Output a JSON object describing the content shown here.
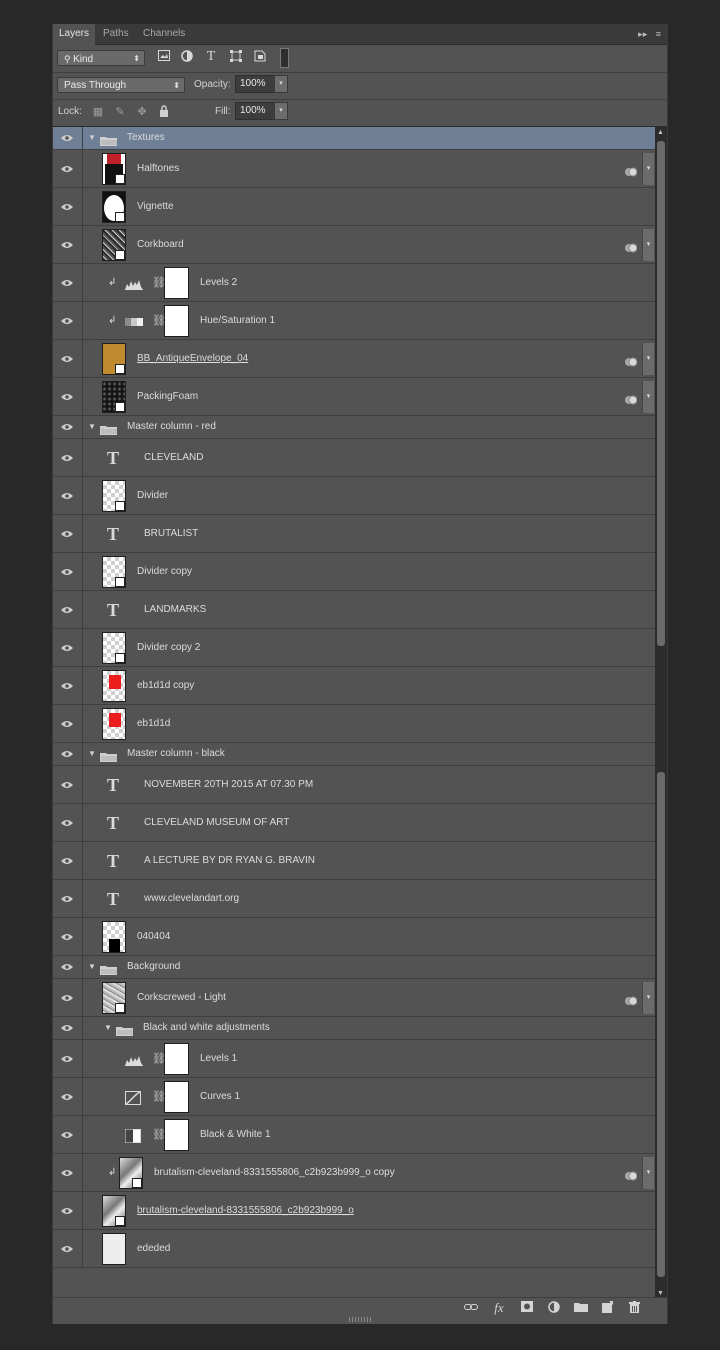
{
  "tabs": [
    {
      "label": "Layers",
      "active": true
    },
    {
      "label": "Paths",
      "active": false
    },
    {
      "label": "Channels",
      "active": false
    }
  ],
  "panel_controls": {
    "collapse": "▸▸",
    "menu": "≡"
  },
  "filter": {
    "kind_label": "Kind",
    "icons": [
      "image-filter-icon",
      "adjustment-filter-icon",
      "type-filter-icon",
      "shape-filter-icon",
      "smartobject-filter-icon",
      "filter-toggle-icon"
    ]
  },
  "blend": {
    "mode": "Pass Through",
    "opacity_label": "Opacity:",
    "opacity": "100%"
  },
  "lock": {
    "label": "Lock:",
    "fill_label": "Fill:",
    "fill": "100%"
  },
  "layers": [
    {
      "kind": "group",
      "name": "Textures",
      "indent": 0,
      "selected": true
    },
    {
      "kind": "smart",
      "name": "Halftones",
      "thumb": "halftones",
      "smart": true,
      "selected": false
    },
    {
      "kind": "smart",
      "name": "Vignette",
      "thumb": "vignette",
      "smart": false
    },
    {
      "kind": "smart",
      "name": "Corkboard",
      "thumb": "noise",
      "smart": true
    },
    {
      "kind": "adjust",
      "name": "Levels 2",
      "adj": "levels",
      "clip": true
    },
    {
      "kind": "adjust",
      "name": "Hue/Saturation 1",
      "adj": "hue",
      "clip": true
    },
    {
      "kind": "smart",
      "name": "BB_AntiqueEnvelope_04",
      "thumb": "envelope",
      "smart": true,
      "underline": true
    },
    {
      "kind": "smart",
      "name": "PackingFoam",
      "thumb": "dark",
      "smart": true
    },
    {
      "kind": "group",
      "name": "Master column - red",
      "indent": 0
    },
    {
      "kind": "text",
      "name": "CLEVELAND"
    },
    {
      "kind": "smart",
      "name": "Divider",
      "thumb": "checker",
      "smart": false
    },
    {
      "kind": "text",
      "name": "BRUTALIST"
    },
    {
      "kind": "smart",
      "name": "Divider copy",
      "thumb": "checker",
      "smart": false
    },
    {
      "kind": "text",
      "name": "LANDMARKS"
    },
    {
      "kind": "smart",
      "name": "Divider copy 2",
      "thumb": "checker",
      "smart": false
    },
    {
      "kind": "pixel",
      "name": "eb1d1d copy",
      "thumb": "red"
    },
    {
      "kind": "pixel",
      "name": "eb1d1d",
      "thumb": "red"
    },
    {
      "kind": "group",
      "name": "Master column - black",
      "indent": 0
    },
    {
      "kind": "text",
      "name": "NOVEMBER 20TH 2015 AT 07.30 PM"
    },
    {
      "kind": "text",
      "name": "CLEVELAND MUSEUM OF ART"
    },
    {
      "kind": "text",
      "name": "A LECTURE BY DR RYAN G. BRAVIN"
    },
    {
      "kind": "text",
      "name": "www.clevelandart.org"
    },
    {
      "kind": "pixel",
      "name": "040404",
      "thumb": "black"
    },
    {
      "kind": "group",
      "name": "Background",
      "indent": 0
    },
    {
      "kind": "smart",
      "name": "Corkscrewed - Light",
      "thumb": "noise-light",
      "smart": true
    },
    {
      "kind": "group",
      "name": "Black and white adjustments",
      "indent": 1
    },
    {
      "kind": "adjust",
      "name": "Levels 1",
      "adj": "levels",
      "clip": false
    },
    {
      "kind": "adjust",
      "name": "Curves 1",
      "adj": "curves",
      "clip": false
    },
    {
      "kind": "adjust",
      "name": "Black & White 1",
      "adj": "bw",
      "clip": false
    },
    {
      "kind": "clipped-smart",
      "name": "brutalism-cleveland-8331555806_c2b923b999_o  copy",
      "thumb": "photo",
      "smart": true
    },
    {
      "kind": "smart",
      "name": "brutalism-cleveland-8331555806_c2b923b999_o",
      "thumb": "photo",
      "smart": false,
      "underline": true
    },
    {
      "kind": "pixel",
      "name": "ededed",
      "thumb": "light"
    }
  ],
  "footer_icons": [
    "link-layers-icon",
    "fx-icon",
    "add-mask-icon",
    "new-adjustment-icon",
    "new-group-icon",
    "new-layer-icon",
    "trash-icon"
  ],
  "colors": {
    "panel": "#535353",
    "selected": "#6e7f96",
    "red_fill": "#eb1d1d",
    "envelope": "#c08a2e"
  }
}
